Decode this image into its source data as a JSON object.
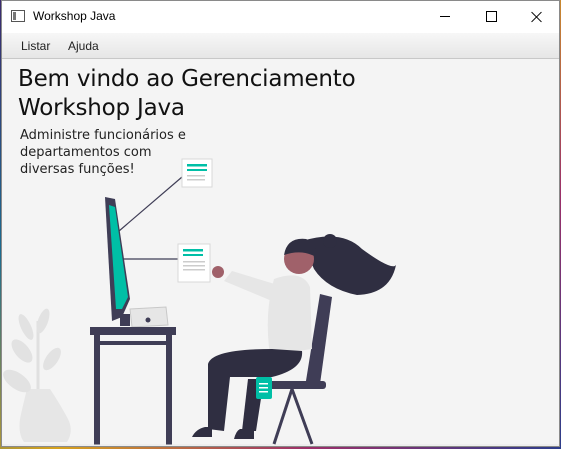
{
  "window": {
    "title": "Workshop Java",
    "icon": "java-window-icon",
    "controls": [
      "minimize-icon",
      "maximize-icon",
      "close-icon"
    ]
  },
  "menu": {
    "items": [
      {
        "label": "Listar"
      },
      {
        "label": "Ajuda"
      }
    ]
  },
  "main": {
    "title_line1": "Bem vindo ao Gerenciamento",
    "title_line2": "Workshop Java",
    "subtitle": "Administre funcionários e departamentos com diversas funções!"
  },
  "colors": {
    "accent": "#00bfa6",
    "dark": "#3f3d56",
    "skin": "#a0616a",
    "hair": "#2f2e41"
  }
}
